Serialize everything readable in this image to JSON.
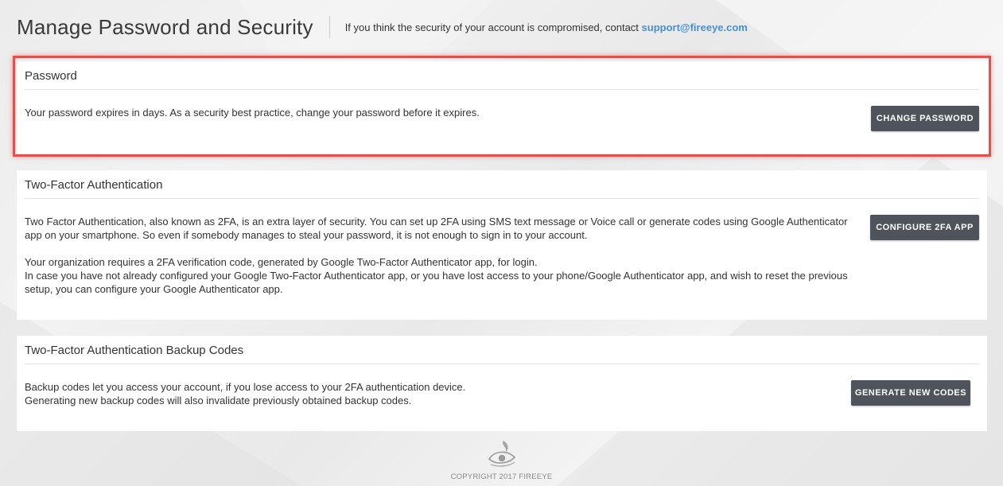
{
  "header": {
    "title": "Manage Password and Security",
    "note": "If you think the security of your account is compromised, contact",
    "support_email": "support@fireeye.com"
  },
  "password_section": {
    "title": "Password",
    "text": "Your password expires in days. As a security best practice, change your password before it expires.",
    "button": "CHANGE PASSWORD"
  },
  "twofa_section": {
    "title": "Two-Factor Authentication",
    "paragraph1": "Two Factor Authentication, also known as 2FA, is an extra layer of security. You can set up 2FA using SMS text message or Voice call or generate codes using Google Authenticator app on your smartphone. So even if somebody manages to steal your password, it is not enough to sign in to your account.",
    "line1": "Your organization requires a 2FA verification code, generated by Google Two-Factor Authenticator app, for login.",
    "line2": "In case you have not already configured your Google Two-Factor Authenticator app, or you have lost access to your phone/Google Authenticator app, and wish to reset the previous setup, you can configure your Google Authenticator app.",
    "button": "CONFIGURE 2FA APP"
  },
  "backup_section": {
    "title": "Two-Factor Authentication Backup Codes",
    "line1": "Backup codes let you access your account, if you lose access to your 2FA authentication device.",
    "line2": "Generating new backup codes will also invalidate previously obtained backup codes.",
    "button": "GENERATE NEW CODES"
  },
  "footer": {
    "logo_icon": "fireeye-eye-logo",
    "copyright": "COPYRIGHT 2017 FIREEYE"
  },
  "colors": {
    "accent_link": "#4a8fd0",
    "button_bg": "#4f535c",
    "highlight_border": "#e0524e"
  }
}
